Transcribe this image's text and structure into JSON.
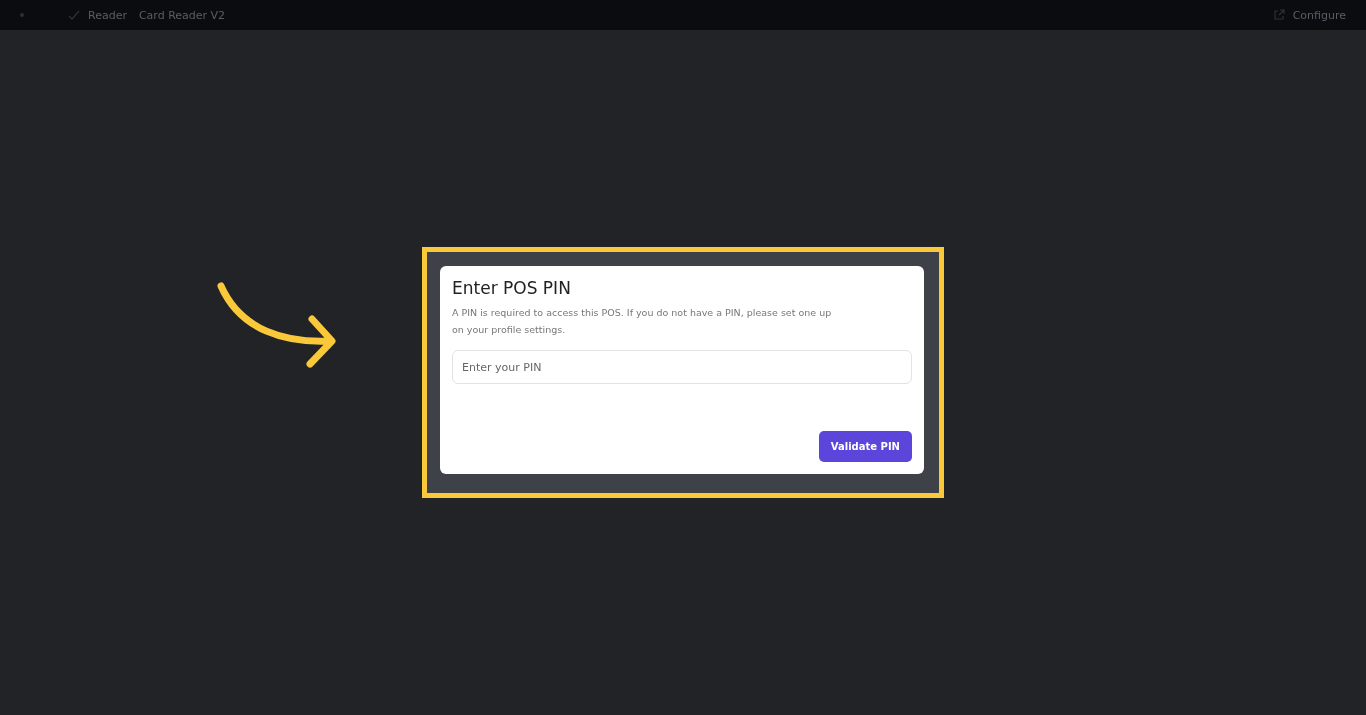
{
  "top_bar": {
    "breadcrumb": [
      "Reader",
      "Card Reader V2"
    ],
    "configure_label": "Configure"
  },
  "dialog": {
    "title": "Enter POS PIN",
    "description": "A PIN is required to access this POS. If you do not have a PIN, please set one up on your profile settings.",
    "pin_field": {
      "placeholder": "Enter your PIN"
    },
    "button": "Validate PIN"
  }
}
